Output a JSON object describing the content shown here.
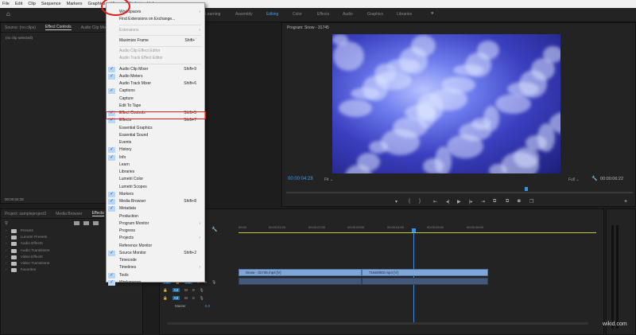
{
  "menubar": [
    "File",
    "Edit",
    "Clip",
    "Sequence",
    "Markers",
    "Graphics",
    "View",
    "Window",
    "Help"
  ],
  "workspaces": [
    "Learning",
    "Assembly",
    "Editing",
    "Color",
    "Effects",
    "Audio",
    "Graphics",
    "Libraries"
  ],
  "workspace_more": "»",
  "source_panel": {
    "tabs": [
      "Source: (no clips)",
      "Effect Controls",
      "Audio Clip Mixer"
    ],
    "empty": "(no clip selected)",
    "timecode": "00:00:04:28"
  },
  "program": {
    "title": "Program: Snow - 31745",
    "timecode": "00:00:04:28",
    "fit": "Fit",
    "quality": "Full",
    "duration": "00:00:06:22"
  },
  "window_menu": [
    {
      "label": "Workspaces",
      "arrow": true
    },
    {
      "label": "Find Extensions on Exchange..."
    },
    {
      "sep": true
    },
    {
      "label": "Extensions",
      "arrow": true,
      "disabled": true
    },
    {
      "sep": true
    },
    {
      "label": "Maximize Frame",
      "shortcut": "Shift+`"
    },
    {
      "sep": true
    },
    {
      "label": "Audio Clip Effect Editor",
      "disabled": true
    },
    {
      "label": "Audio Track Effect Editor",
      "disabled": true
    },
    {
      "sep": true
    },
    {
      "label": "Audio Clip Mixer",
      "shortcut": "Shift+9",
      "checked": true
    },
    {
      "label": "Audio Meters",
      "checked": true
    },
    {
      "label": "Audio Track Mixer",
      "shortcut": "Shift+6"
    },
    {
      "label": "Captions",
      "checked": true
    },
    {
      "label": "Capture"
    },
    {
      "label": "Edit To Tape"
    },
    {
      "label": "Effect Controls",
      "shortcut": "Shift+5",
      "checked": true
    },
    {
      "label": "Effects",
      "shortcut": "Shift+7",
      "checked": true
    },
    {
      "label": "Essential Graphics"
    },
    {
      "label": "Essential Sound"
    },
    {
      "label": "Events"
    },
    {
      "label": "History",
      "checked": true
    },
    {
      "label": "Info",
      "checked": true
    },
    {
      "label": "Learn"
    },
    {
      "label": "Libraries"
    },
    {
      "label": "Lumetri Color"
    },
    {
      "label": "Lumetri Scopes"
    },
    {
      "label": "Markers",
      "checked": true
    },
    {
      "label": "Media Browser",
      "shortcut": "Shift+8",
      "checked": true
    },
    {
      "label": "Metadata",
      "checked": true
    },
    {
      "label": "Production"
    },
    {
      "label": "Program Monitor",
      "arrow": true
    },
    {
      "label": "Progress"
    },
    {
      "label": "Projects",
      "arrow": true
    },
    {
      "label": "Reference Monitor"
    },
    {
      "label": "Source Monitor",
      "shortcut": "Shift+2",
      "checked": true
    },
    {
      "label": "Timecode"
    },
    {
      "label": "Timelines",
      "arrow": true
    },
    {
      "label": "Tools",
      "checked": true
    },
    {
      "label": "Workspaces",
      "checked": true
    }
  ],
  "project_panel": {
    "tabs": [
      "Project: sampleproject2",
      "Media Browser",
      "Effects"
    ],
    "folders": [
      "Presets",
      "Lumetri Presets",
      "Audio Effects",
      "Audio Transitions",
      "Video Effects",
      "Video Transitions",
      "Favorites"
    ]
  },
  "timeline": {
    "ruler": [
      "00:00",
      "00:00:01:00",
      "00:00:02:00",
      "00:00:03:00",
      "00:00:04:00",
      "00:00:05:00",
      "00:00:06:00"
    ],
    "clips": [
      "Snow - 31745.mp4 [V]",
      "71564902.mp4 [V]"
    ],
    "tracks": [
      "A1",
      "A2",
      "A3"
    ],
    "master": "Master",
    "master_val": "0.0",
    "mute": "M",
    "solo": "S"
  },
  "watermark": "wikid.com",
  "colors": {
    "accent": "#3f9bf0",
    "highlight": "#e21b1b",
    "playhead": "#3b8fe0"
  }
}
